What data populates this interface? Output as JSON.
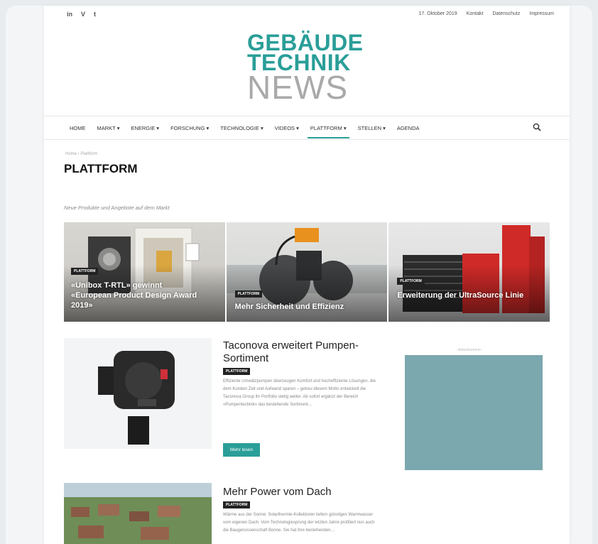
{
  "topbar": {
    "social": [
      "in",
      "V",
      "t"
    ],
    "date": "17. Oktober 2019",
    "links": [
      "Kontakt",
      "Datenschutz",
      "Impressum"
    ]
  },
  "logo": {
    "line1": "GEBÄUDE",
    "line2": "TECHNIK",
    "line3": "NEWS"
  },
  "nav": {
    "items": [
      "HOME",
      "MARKT ▾",
      "ENERGIE ▾",
      "FORSCHUNG ▾",
      "TECHNOLOGIE ▾",
      "VIDEOS ▾",
      "PLATTFORM ▾",
      "STELLEN ▾",
      "AGENDA"
    ],
    "active_index": 6
  },
  "page": {
    "breadcrumb": "Home › Plattform",
    "title": "PLATTFORM",
    "subtitle": "Neue Produkte und Angebote auf dem Markt"
  },
  "featured": [
    {
      "tag": "PLATTFORM",
      "title": "«Unibox T-RTL» gewinnt «European Product Design Award 2019»"
    },
    {
      "tag": "PLATTFORM",
      "title": "Mehr Sicherheit und Effizienz"
    },
    {
      "tag": "PLATTFORM",
      "title": "Erweiterung der UltraSource Linie"
    }
  ],
  "articles": [
    {
      "title": "Taconova erweitert Pumpen-Sortiment",
      "tag": "PLATTFORM",
      "excerpt": "Effiziente Umwälzpumpen überzeugen Komfort und hocheffiziente Lösungen, die dem Kunden Zeit und Aufwand sparen – getreu diesem Motto entwickelt die Taconova Group ihr Portfolio stetig weiter. Ab sofort ergänzt der Bereich «Pumpentechnik» das bestehende Sortiment…",
      "button": "Mehr lesen"
    },
    {
      "title": "Mehr Power vom Dach",
      "tag": "PLATTFORM",
      "excerpt": "Wärme aus der Sonne: Solarthermie-Kollektoren liefern günstiges Warmwasser vom eigenen Dach. Vom Technologiesprung der letzten Jahre profitiert nun auch die Baugenossenschaft Bonne. Sie hat ihre bestehenden…"
    }
  ],
  "sidebar": {
    "ad_label": "- Advertisement -"
  },
  "colors": {
    "accent": "#2a9e98",
    "ad": "#7ba7ae"
  }
}
